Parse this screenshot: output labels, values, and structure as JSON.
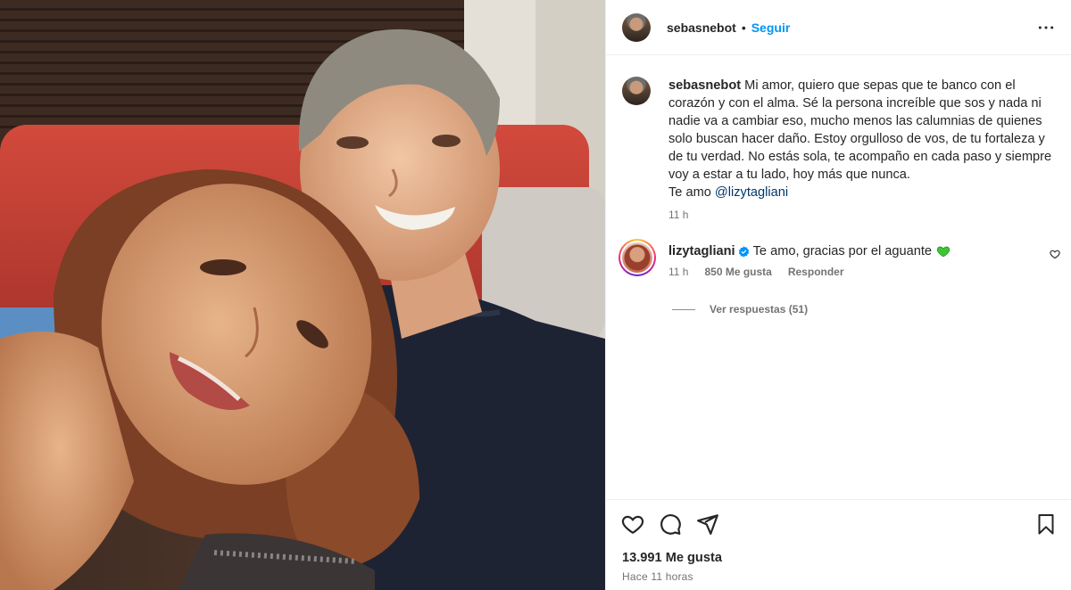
{
  "post": {
    "author": "sebasnebot",
    "separator": "•",
    "follow_label": "Seguir",
    "more_icon": "more-horizontal-icon",
    "image_alt": "selfie-photo"
  },
  "caption": {
    "author": "sebasnebot",
    "text": " Mi amor, quiero que sepas que te banco con el corazón y con el alma. Sé la persona increíble que sos y nada ni nadie va a cambiar eso, mucho menos las calumnias de quienes solo buscan hacer daño. Estoy orgulloso de vos, de tu fortaleza y de tu verdad. No estás sola, te acompaño en cada paso y siempre voy a estar a tu lado, hoy más que nunca.",
    "closing": "Te amo ",
    "mention": "@lizytagliani",
    "age": "11 h"
  },
  "comment": {
    "author": "lizytagliani",
    "verified": true,
    "text": "Te amo, gracias por el aguante",
    "emoji_icon": "green-heart-icon",
    "age": "11 h",
    "likes": "850 Me gusta",
    "reply_label": "Responder",
    "view_replies": "Ver respuestas (51)"
  },
  "actions": {
    "like_icon": "heart-icon",
    "comment_icon": "comment-icon",
    "share_icon": "share-icon",
    "save_icon": "bookmark-icon"
  },
  "stats": {
    "likes": "13.991 Me gusta",
    "posted": "Hace 11 horas"
  },
  "colors": {
    "link_blue": "#0095f6",
    "mention_blue": "#00376b",
    "verified_blue": "#0095f6",
    "muted": "#737373"
  }
}
